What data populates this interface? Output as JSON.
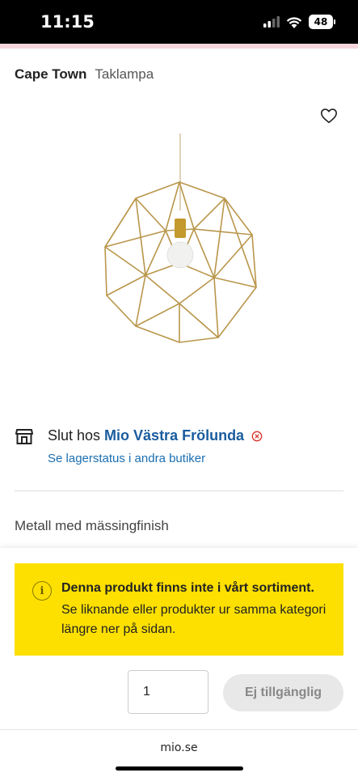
{
  "status_bar": {
    "time": "11:15",
    "battery": "48"
  },
  "breadcrumb": {
    "brand": "Cape Town",
    "category": "Taklampa"
  },
  "store": {
    "prefix": "Slut hos",
    "name": "Mio Västra Frölunda",
    "link": "Se lagerstatus i andra butiker"
  },
  "material": "Metall med mässingfinish",
  "notice": {
    "title": "Denna produkt finns inte i vårt sortiment.",
    "body": "Se liknande eller produkter ur samma kategori längre ner på sidan."
  },
  "quantity": {
    "value": "1"
  },
  "buy_button": {
    "label": "Ej tillgänglig"
  },
  "browser": {
    "url": "mio.se"
  },
  "colors": {
    "notice_bg": "#fde000",
    "link": "#1a6fb2",
    "strip": "#f6d5dd"
  },
  "icons": [
    "signal-icon",
    "wifi-icon",
    "battery-icon",
    "heart-icon",
    "store-icon",
    "close-circle-icon",
    "info-icon"
  ]
}
